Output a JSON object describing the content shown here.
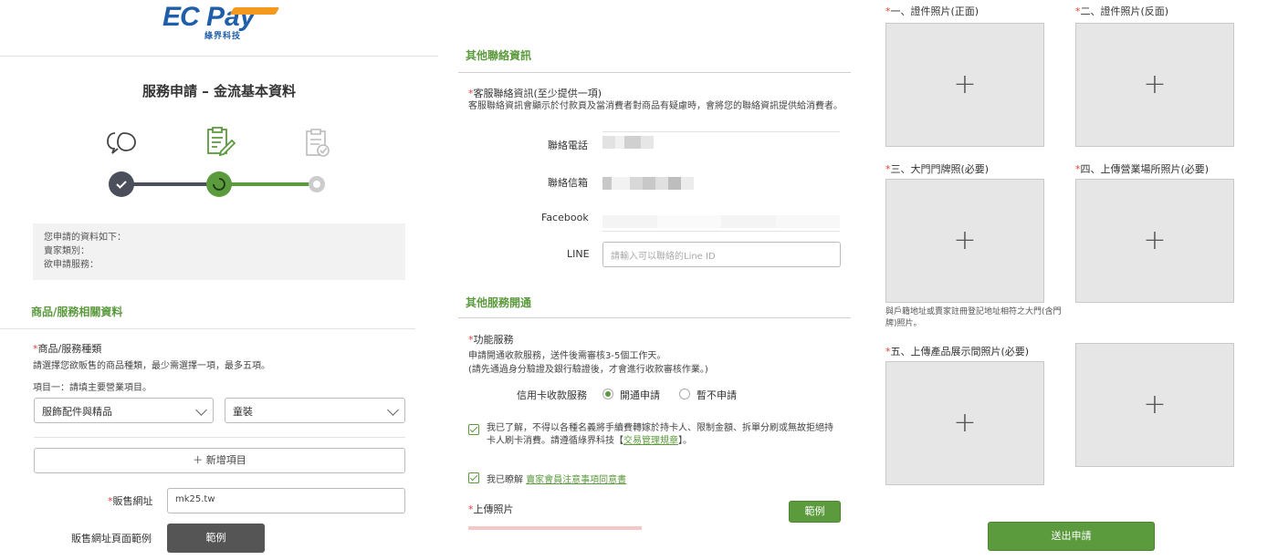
{
  "brand": {
    "logo_ec": "EC",
    "logo_pay": "Pay",
    "logo_cn": "綠界科技"
  },
  "left": {
    "title": "服務申請 – 金流基本資料",
    "info_lines": [
      "您申請的資料如下：",
      "賣家類別：",
      "欲申請服務："
    ],
    "section_title": "商品/服務相關資料",
    "product_type_label": "商品/服務種類",
    "product_type_desc": "請選擇您欲販售的商品種類，最少需選擇一項，最多五項。",
    "item_one_note": "項目一：請填主要營業項目。",
    "select_category": "服飾配件與精品",
    "select_subcategory": "童裝",
    "add_item_label": "＋ 新增項目",
    "sales_url_label": "販售網址",
    "sales_url_value": "mk25.tw",
    "sales_page_example_label": "販售網址頁面範例",
    "example_button": "範例"
  },
  "middle": {
    "section_contact_title": "其他聯絡資訊",
    "cs_contact_label": "客服聯絡資訊(至少提供一項)",
    "cs_contact_desc": "客服聯絡資訊會顯示於付款頁及當消費者對商品有疑慮時，會將您的聯絡資訊提供給消費者。",
    "phone_label": "聯絡電話",
    "email_label": "聯絡信箱",
    "facebook_label": "Facebook",
    "line_label": "LINE",
    "line_placeholder": "請輸入可以聯絡的Line ID",
    "section_service_title": "其他服務開通",
    "feature_label": "功能服務",
    "feature_desc": "申請開通收款服務，送件後需審核3-5個工作天。",
    "feature_warning": "(請先通過身分驗證及銀行驗證後，才會進行收款審核作業。)",
    "credit_card_label": "信用卡收款服務",
    "radio_apply": "開通申請",
    "radio_decline": "暫不申請",
    "agree1_text": "我已了解，不得以各種名義將手續費轉嫁於持卡人、限制金額、拆單分刷或無故拒絕持卡人刷卡消費。請遵循綠界科技【",
    "agree1_link": "交易管理規章",
    "agree1_end": "】。",
    "agree2_text": "我已瞭解 ",
    "agree2_link": "賣家會員注意事項同意書",
    "upload_label": "上傳照片",
    "example_button": "範例",
    "accent_color": "#5b9a3d"
  },
  "right": {
    "uploads": [
      {
        "label": "一、證件照片(正面)"
      },
      {
        "label": "二、證件照片(反面)"
      },
      {
        "label": "三、大門門牌照(必要)"
      },
      {
        "label": "四、上傳營業場所照片(必要)"
      },
      {
        "label": "五、上傳產品展示間照片(必要)"
      },
      {
        "label": ""
      }
    ],
    "plus_icon": "+",
    "doorplate_note": "與戶籍地址或賣家註冊登記地址相符之大門(含門牌)照片。",
    "submit_button": "送出申請"
  }
}
